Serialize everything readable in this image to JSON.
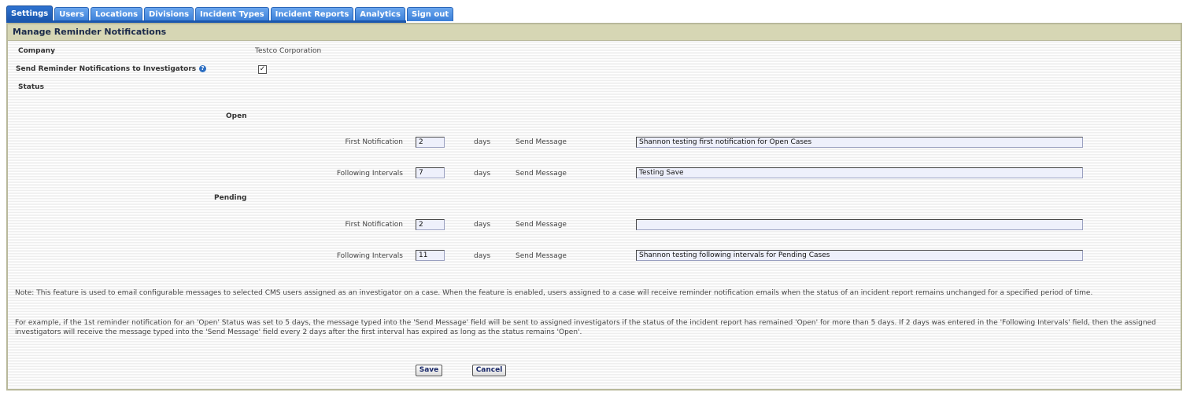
{
  "tabs": [
    {
      "label": "Settings",
      "active": true
    },
    {
      "label": "Users"
    },
    {
      "label": "Locations"
    },
    {
      "label": "Divisions"
    },
    {
      "label": "Incident Types"
    },
    {
      "label": "Incident Reports"
    },
    {
      "label": "Analytics"
    },
    {
      "label": "Sign out"
    }
  ],
  "panel": {
    "title": "Manage Reminder Notifications"
  },
  "company": {
    "label": "Company",
    "value": "Testco Corporation"
  },
  "send_reminder": {
    "label": "Send Reminder Notifications to Investigators",
    "checked": true,
    "help_icon": "help-icon"
  },
  "status_label": "Status",
  "labels": {
    "first_notification": "First Notification",
    "following_intervals": "Following Intervals",
    "days": "days",
    "send_message": "Send Message"
  },
  "open": {
    "heading": "Open",
    "first_days": "2",
    "first_message": "Shannon testing first notification for Open Cases",
    "following_days": "7",
    "following_message": "Testing Save"
  },
  "pending": {
    "heading": "Pending",
    "first_days": "2",
    "first_message": "",
    "following_days": "11",
    "following_message": "Shannon testing following intervals for Pending Cases"
  },
  "notes": {
    "note1": "Note: This feature is used to email configurable messages to selected CMS users assigned as an investigator on a case. When the feature is enabled, users assigned to a case will receive reminder notification emails when the status of an incident report remains unchanged for a specified period of time.",
    "note2": "For example, if the 1st reminder notification for an 'Open' Status was set to 5 days, the message typed into the 'Send Message' field will be sent to assigned investigators if the status of the incident report has remained 'Open' for more than 5 days. If 2 days was entered in the 'Following Intervals' field, then the assigned investigators will receive the message typed into the 'Send Message' field every 2 days after the first interval has expired as long as the status remains 'Open'."
  },
  "buttons": {
    "save": "Save",
    "cancel": "Cancel"
  }
}
